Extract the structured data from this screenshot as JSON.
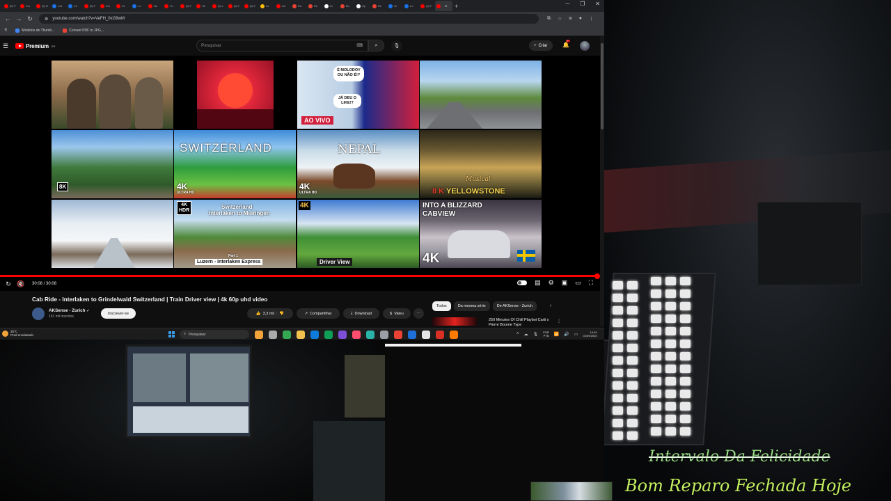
{
  "browser": {
    "tabs": [
      {
        "label": "(8) P",
        "color": "#ff0000"
      },
      {
        "label": "Tra",
        "color": "#ff0000"
      },
      {
        "label": "(8) B",
        "color": "#ff0000"
      },
      {
        "label": "Cal",
        "color": "#1a73e8"
      },
      {
        "label": "Ce",
        "color": "#1a73e8"
      },
      {
        "label": "(8) F",
        "color": "#ff0000"
      },
      {
        "label": "Em",
        "color": "#ff0000"
      },
      {
        "label": "Int",
        "color": "#ff0000"
      },
      {
        "label": "Lo",
        "color": "#1a73e8"
      },
      {
        "label": "Ne",
        "color": "#ff0000"
      },
      {
        "label": "Yo",
        "color": "#ff0000"
      },
      {
        "label": "(8) F",
        "color": "#ff0000"
      },
      {
        "label": "Tel",
        "color": "#ff0000"
      },
      {
        "label": "(8) L",
        "color": "#ff0000"
      },
      {
        "label": "(8) F",
        "color": "#ff0000"
      },
      {
        "label": "(8) F",
        "color": "#ff0000"
      },
      {
        "label": "Av",
        "color": "#fbbc04"
      },
      {
        "label": "Ad",
        "color": "#ff0000"
      },
      {
        "label": "Ra",
        "color": "#ea4335"
      },
      {
        "label": "Re",
        "color": "#ea4335"
      },
      {
        "label": "Im",
        "color": "#ffffff"
      },
      {
        "label": "Bu",
        "color": "#ea4335"
      },
      {
        "label": "Op",
        "color": "#ffffff"
      },
      {
        "label": "Re",
        "color": "#ea4335"
      },
      {
        "label": "Gr",
        "color": "#1a73e8"
      },
      {
        "label": "Lo",
        "color": "#1a73e8"
      },
      {
        "label": "(8) F",
        "color": "#ff0000"
      },
      {
        "label": "",
        "color": "#ff0000",
        "active": true
      }
    ],
    "url": "youtube.com/watch?v=VeFH_0xG9wM",
    "bookmarks": [
      {
        "label": "Modelos de Thumb...",
        "color": "#4285f4"
      },
      {
        "label": "Convert PDF to JPG...",
        "color": "#ea4335"
      }
    ]
  },
  "youtube": {
    "logo": "Premium",
    "logo_sup": "BR",
    "search_placeholder": "Pesquisar",
    "create_label": "Criar",
    "notif_count": "9+"
  },
  "endscreen": [
    {
      "label": "",
      "bg": "linear-gradient(180deg,#c9a57c 0%,#8a6a4a 50%,#3a4a2a 100%)"
    },
    {
      "label": "",
      "bg": "radial-gradient(circle at 50% 45%,#ff6a4a 0%,#e2273b 35%,#8d0f24 100%)"
    },
    {
      "label": "AO VIVO",
      "bg": "linear-gradient(90deg,#d9e6f2 0%,#b8cde3 45%,#1b2b8a 55%,#d21f3c 100%)"
    },
    {
      "label": "",
      "bg": "linear-gradient(180deg,#7eb2e6 0%,#b8d6ef 30%,#5e8a3c 55%,#6d6f72 75%,#8f9294 100%)"
    },
    {
      "label": "8K",
      "bg": "linear-gradient(180deg,#4d8fd6 0%,#9cc7ec 25%,#3f7a3c 55%,#2f5a2a 80%,#7a6a5c 100%)"
    },
    {
      "label": "SWITZERLAND",
      "bg": "linear-gradient(180deg,#3f8bd9 0%,#8ec4ef 25%,#2e9d3d 55%,#6bc143 80%,#c73a2e 100%)"
    },
    {
      "label": "NEPAL",
      "bg": "linear-gradient(180deg,#5a8fc4 0%,#c9dbe8 30%,#eef3f6 55%,#7a4a2a 75%,#3a5a3a 100%)"
    },
    {
      "label": "YELLOWSTONE",
      "bg": "linear-gradient(180deg,#2a2618 0%,#6b5a32 30%,#c9a457 55%,#7a6a3a 75%,#1a1a12 100%)"
    },
    {
      "label": "",
      "bg": "linear-gradient(180deg,#9fb9d4 0%,#e8eef3 35%,#f4f6f8 60%,#7a6a5a 80%,#d8dde2 100%)"
    },
    {
      "label": "Interlaken to Meiringen",
      "bg": "linear-gradient(180deg,#7fb2e3 0%,#c6ddef 30%,#4f8a3a 55%,#8a6a4a 75%,#a39a8a 100%)"
    },
    {
      "label": "Driver View",
      "bg": "linear-gradient(180deg,#3d7ad1 0%,#d8e6f3 35%,#3f8f36 55%,#63a83e 80%,#2c5a24 100%)"
    },
    {
      "label": "INTO A BLIZZARD CABVIEW",
      "bg": "linear-gradient(180deg,#3a3440 0%,#6a6470 30%,#c9c2c8 55%,#9c9aa3 75%,#4a4550 100%)"
    }
  ],
  "endscreen_texts": {
    "ao_vivo": "AO VIVO",
    "badge_8k": "8K",
    "switzerland": "SWITZERLAND",
    "badge_4k": "4K",
    "ultra_hd": "ULTRA HD",
    "nepal": "NEPAL",
    "musical": "Musical",
    "yellowstone": "YELLOWSTONE",
    "eightk_prefix": "8 K",
    "badge_4k_hdr_1": "4K",
    "badge_4k_hdr_2": "HDR",
    "interlaken_title_1": "Switzerland",
    "interlaken_title_2": "Interlaken to Meiringen",
    "interlaken_part": "Part 1",
    "interlaken_footer": "Luzern - Interlaken Express",
    "driver_view": "Driver View",
    "blizzard_1": "INTO A BLIZZARD",
    "blizzard_2": "CABVIEW",
    "blizzard_4k": "4K",
    "molodoy_1": "É MOLODOY",
    "molodoy_2": "OU NÃO É!?",
    "ja_deu": "JÁ DEU O",
    "like": "LIKE!?"
  },
  "player": {
    "time": "30:08 / 30:08",
    "progress": 1.0
  },
  "video": {
    "title": "Cab Ride - Interlaken to Grindelwald Switzerland | Train Driver view | 4k 60p uhd video",
    "channel": "AKSense - Zurich",
    "subscribers": "151 mil inscritos",
    "subscribe_label": "Inscrever-se",
    "likes": "3,3 mil",
    "share_label": "Compartilhar",
    "download_label": "Download",
    "thanks_label": "Valeu"
  },
  "sidebar": {
    "chips": [
      "Todos",
      "Da mesma série",
      "De AKSense - Zurich"
    ],
    "rec_title": "250 Minutes Of Chill Playboi Carti x Pierre Bourne Type"
  },
  "taskbar": {
    "temp": "30°C",
    "weather": "Pred ensolarado",
    "search": "Pesquisar",
    "lang": "POR",
    "lang2": "PTB",
    "time": "16:49",
    "date": "01/09/2025",
    "app_colors": [
      "#f2a33a",
      "#aaaaaa",
      "#34a853",
      "#f2c14e",
      "#0f7bd8",
      "#0f9d58",
      "#7b4fd8",
      "#ff4d6d",
      "#2bb3a8",
      "#9aa0a6",
      "#ea4335",
      "#1f6fd8",
      "#e6e6e6",
      "#d93025",
      "#ff7a00"
    ]
  },
  "captions": {
    "line1": "Intervalo Da Felicidade",
    "line2": "Bom Reparo Fechada Hoje"
  }
}
